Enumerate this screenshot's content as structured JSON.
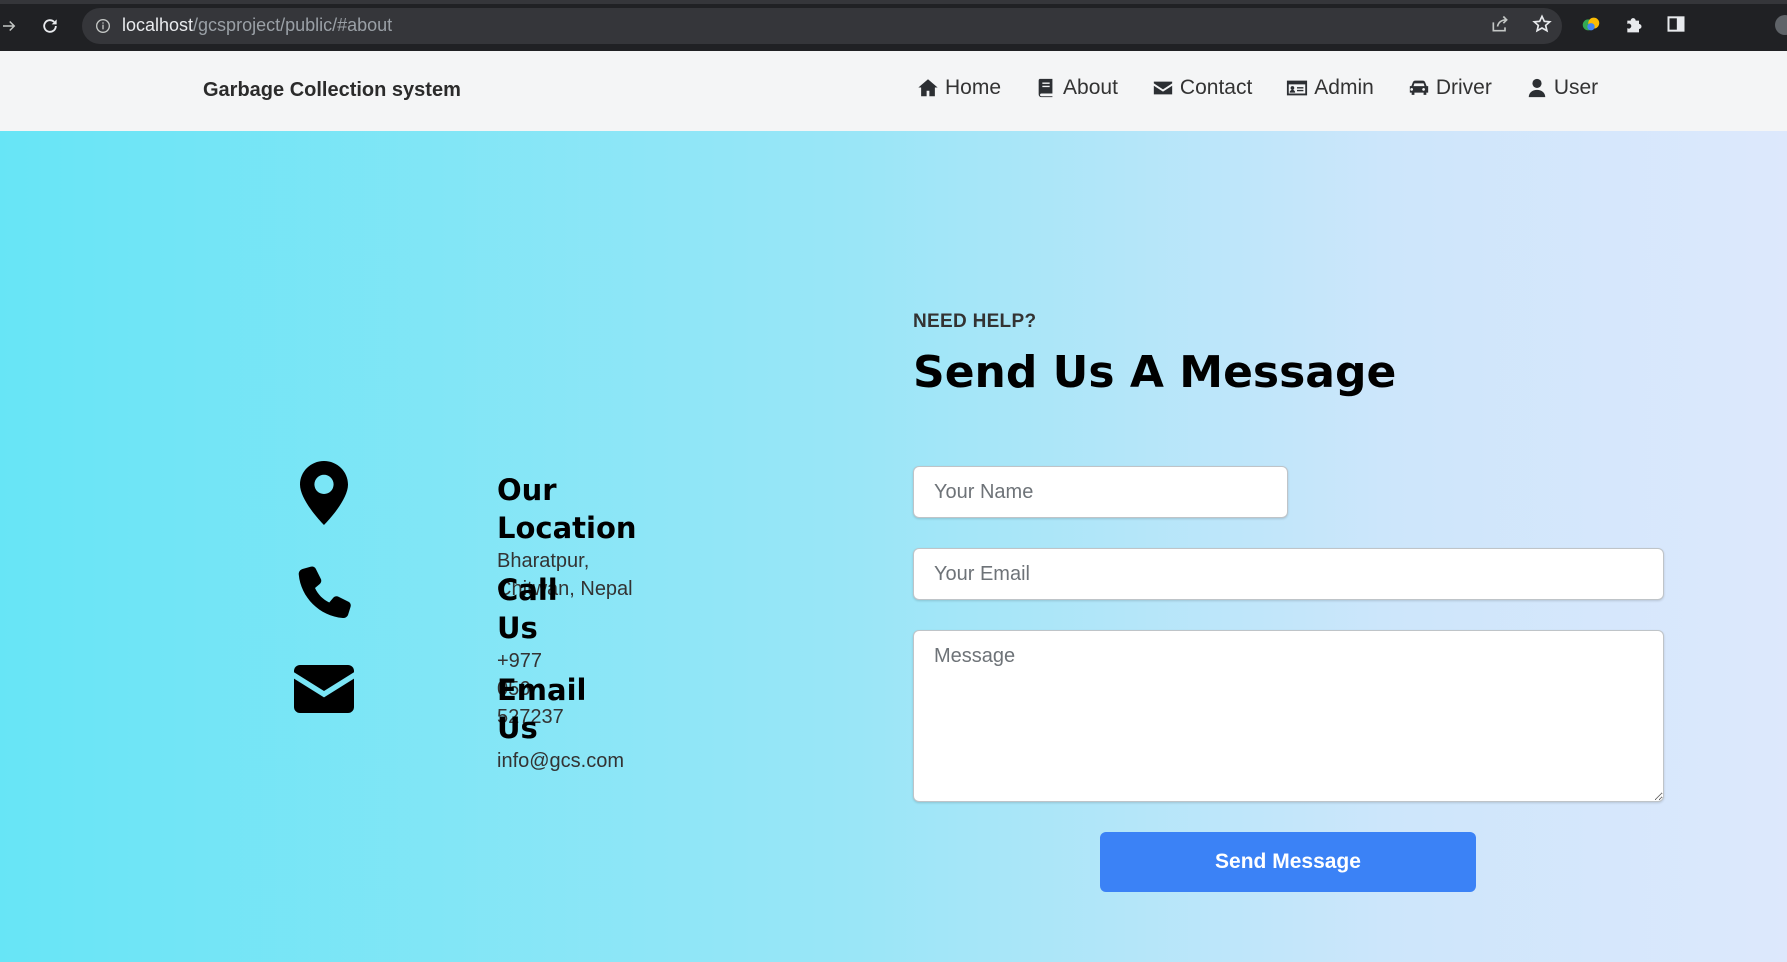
{
  "browser": {
    "url_host": "localhost",
    "url_path": "/gcsproject/public/#about"
  },
  "navbar": {
    "brand": "Garbage Collection system",
    "items": [
      {
        "label": "Home",
        "icon": "home-icon"
      },
      {
        "label": "About",
        "icon": "book-icon"
      },
      {
        "label": "Contact",
        "icon": "envelope-icon"
      },
      {
        "label": "Admin",
        "icon": "id-card-icon"
      },
      {
        "label": "Driver",
        "icon": "car-icon"
      },
      {
        "label": "User",
        "icon": "user-icon"
      }
    ]
  },
  "contact_info": [
    {
      "icon": "location-pin-icon",
      "title": "Our Location",
      "value": "Bharatpur, Chitwan, Nepal"
    },
    {
      "icon": "phone-icon",
      "title": "Call Us",
      "value": "+977 056 527237"
    },
    {
      "icon": "envelope-icon",
      "title": "Email Us",
      "value": "info@gcs.com"
    }
  ],
  "form": {
    "eyebrow": "NEED HELP?",
    "heading": "Send Us A Message",
    "name_placeholder": "Your Name",
    "email_placeholder": "Your Email",
    "message_placeholder": "Message",
    "submit_label": "Send Message"
  },
  "colors": {
    "accent": "#3b82f6",
    "gradient_start": "#67e5f6",
    "gradient_end": "#dde8fc"
  }
}
